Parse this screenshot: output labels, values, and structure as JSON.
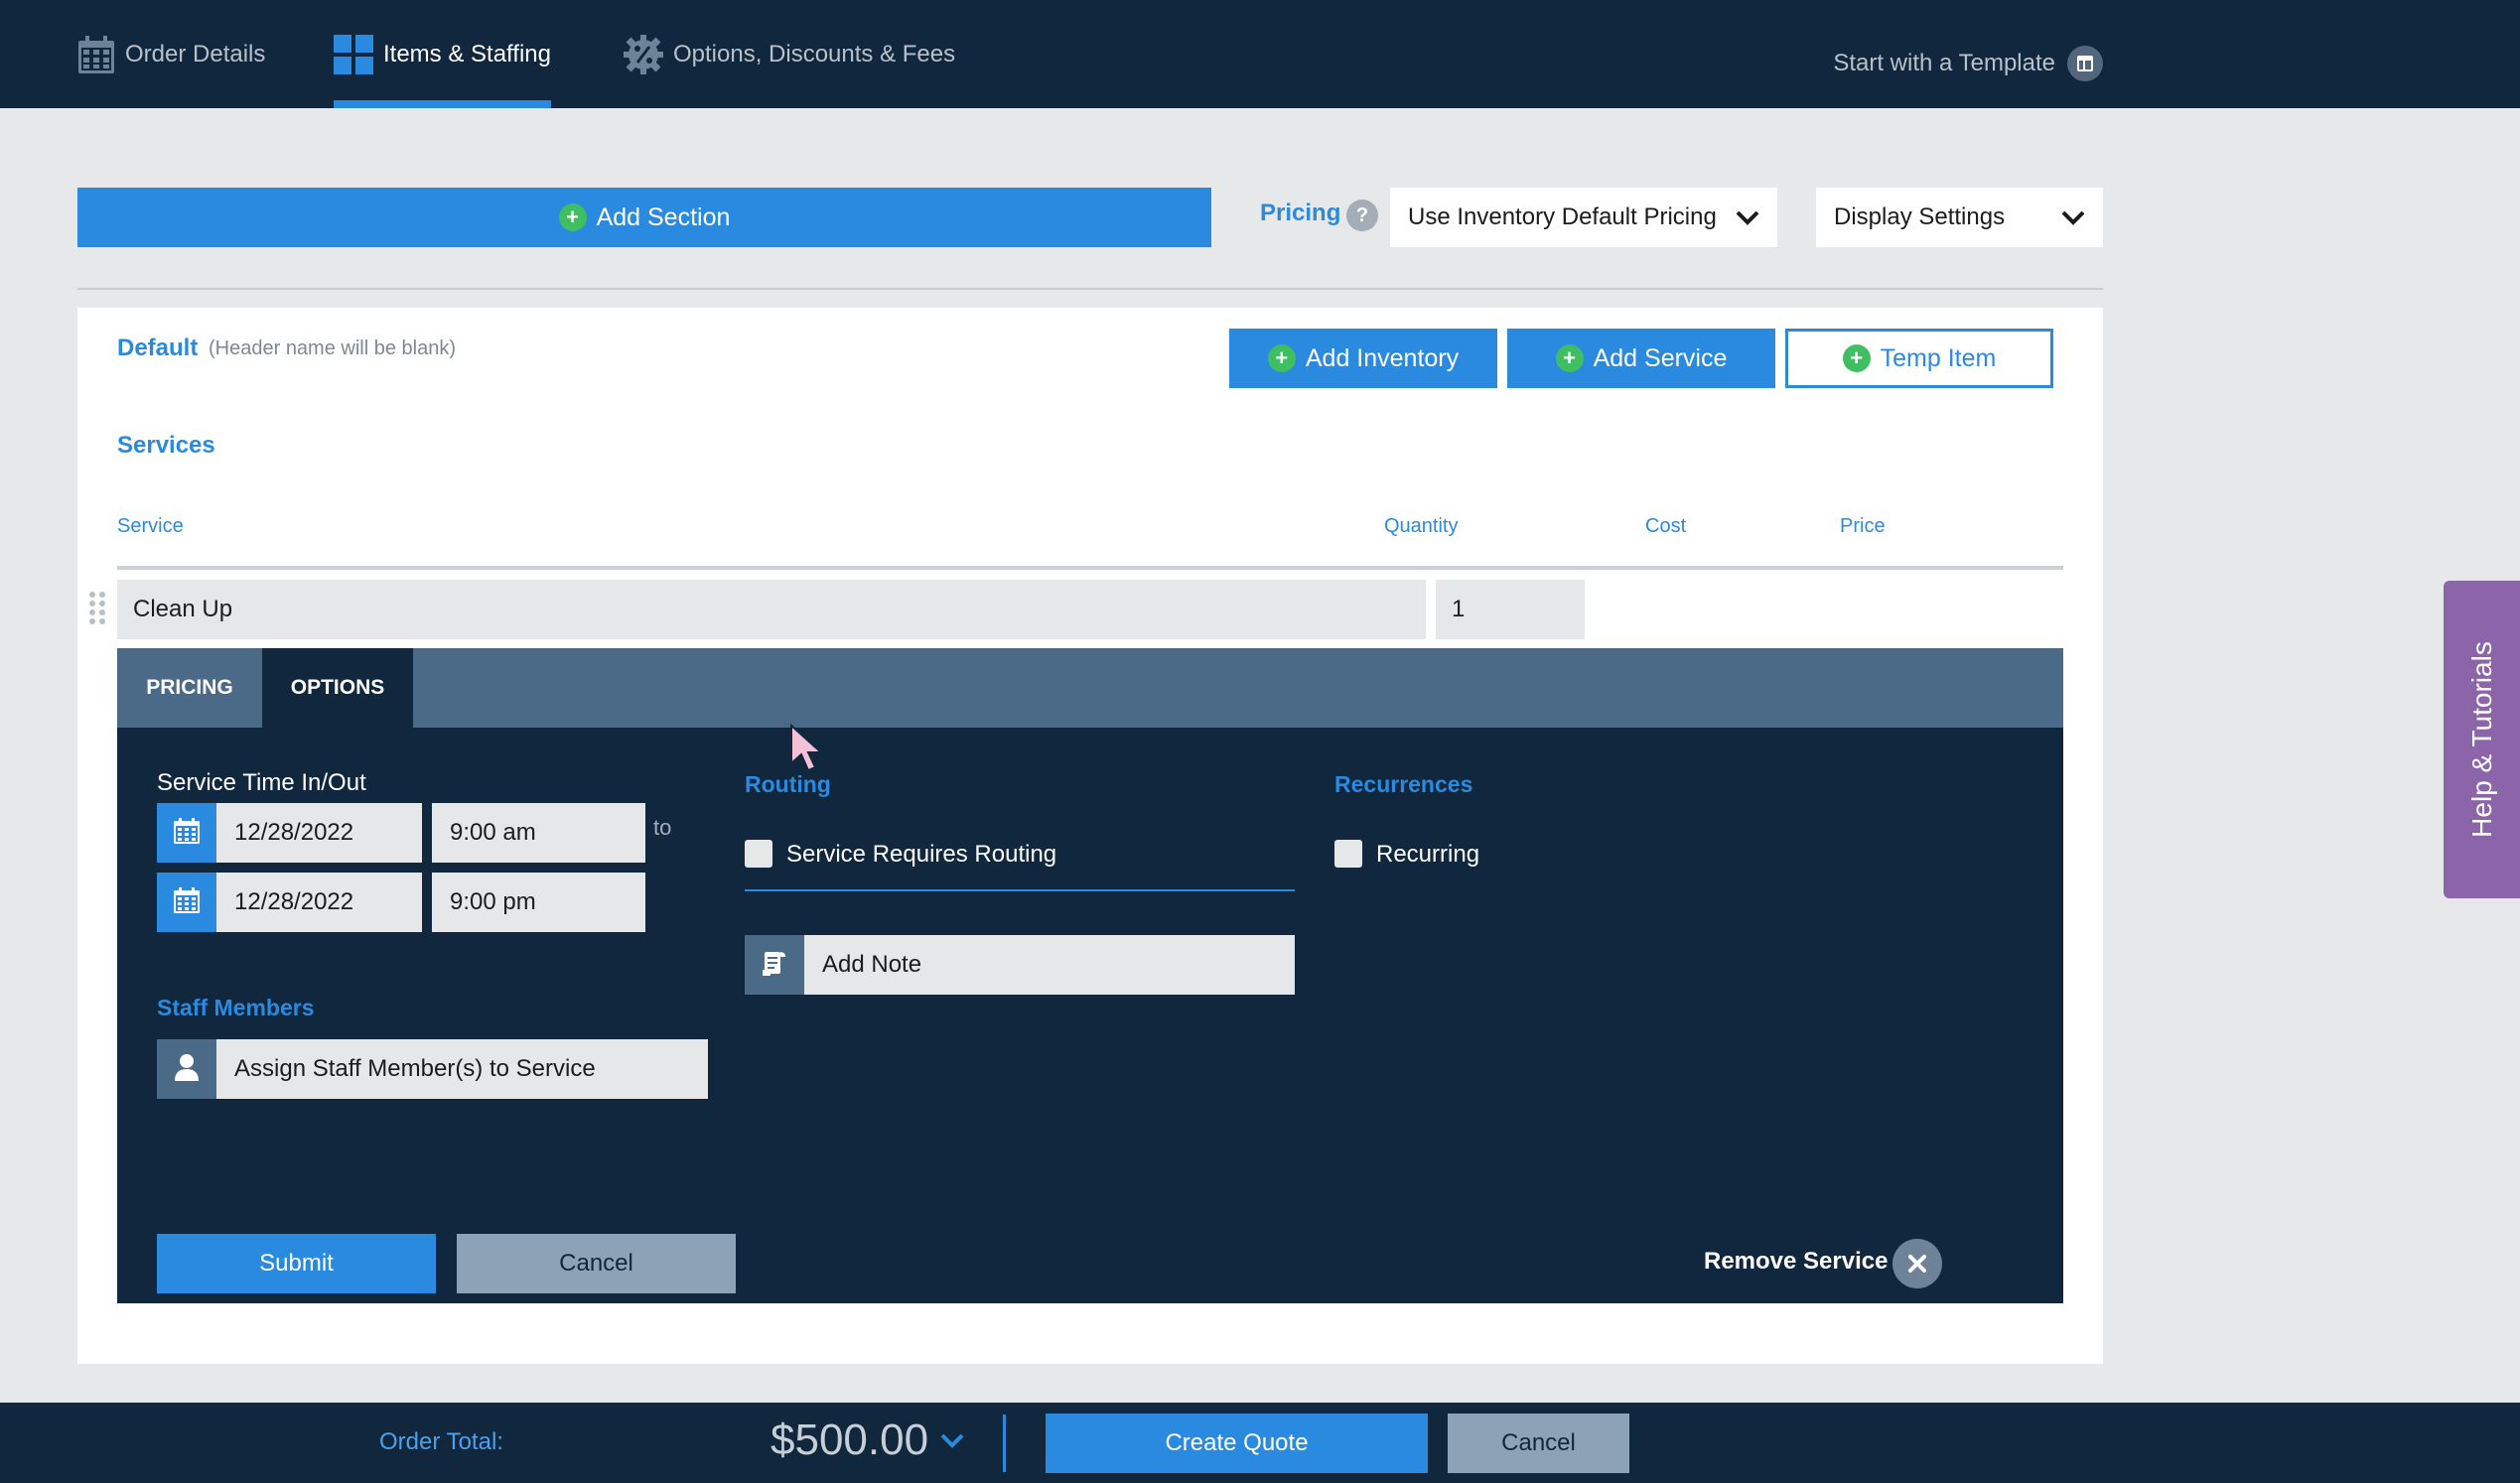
{
  "nav": {
    "tabs": [
      {
        "label": "Order Details",
        "icon": "calendar-icon",
        "active": false
      },
      {
        "label": "Items & Staffing",
        "icon": "grid-icon",
        "active": true
      },
      {
        "label": "Options, Discounts & Fees",
        "icon": "percent-gear-icon",
        "active": false
      }
    ],
    "template_label": "Start with a Template"
  },
  "toolbar": {
    "add_section_label": "Add Section",
    "pricing_label": "Pricing",
    "pricing_help": "?",
    "pricing_select": "Use Inventory Default Pricing",
    "display_settings": "Display Settings"
  },
  "section": {
    "title": "Default",
    "note": "(Header name will be blank)",
    "add_inventory": "Add Inventory",
    "add_service": "Add Service",
    "temp_item": "Temp Item",
    "services_heading": "Services",
    "columns": {
      "service": "Service",
      "quantity": "Quantity",
      "cost": "Cost",
      "price": "Price"
    },
    "row": {
      "service": "Clean Up",
      "quantity": "1"
    }
  },
  "options_panel": {
    "tabs": [
      {
        "label": "PRICING",
        "active": false
      },
      {
        "label": "OPTIONS",
        "active": true
      }
    ],
    "time_label": "Service Time In/Out",
    "start_date": "12/28/2022",
    "start_time": "9:00 am",
    "to_label": "to",
    "end_date": "12/28/2022",
    "end_time": "9:00 pm",
    "staff_heading": "Staff Members",
    "assign_staff": "Assign Staff Member(s) to Service",
    "routing_heading": "Routing",
    "routing_checkbox": "Service Requires Routing",
    "routing_checked": false,
    "add_note": "Add Note",
    "recurrences_heading": "Recurrences",
    "recurring_checkbox": "Recurring",
    "recurring_checked": false,
    "submit": "Submit",
    "cancel": "Cancel",
    "remove_service": "Remove Service"
  },
  "help_tab": "Help & Tutorials",
  "footer": {
    "order_total_label": "Order Total:",
    "order_total": "$500.00",
    "create_quote": "Create Quote",
    "cancel": "Cancel"
  },
  "colors": {
    "nav_bg": "#10273d",
    "accent_blue": "#2a8ae0",
    "add_green": "#3fbf62",
    "panel_tab_bar": "#4a6a88",
    "help_purple": "#8c64aa",
    "cancel_gray": "#8ea2b7"
  }
}
